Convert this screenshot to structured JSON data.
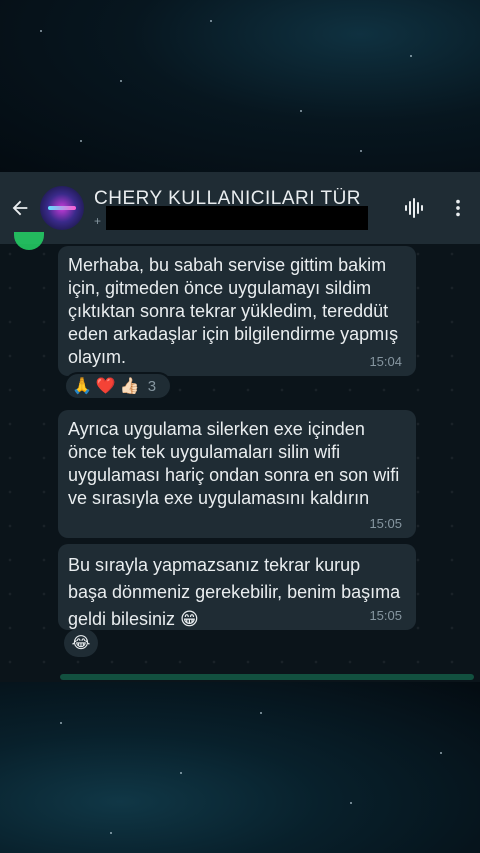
{
  "header": {
    "title": "CHERY KULLANICILARI TÜR",
    "subtitle": "+"
  },
  "messages": [
    {
      "text": "Merhaba, bu sabah servise gittim bakim için, gitmeden önce uygulamayı sildim çıktıktan sonra tekrar yükledim, tereddüt eden arkadaşlar için bilgilendirme yapmış olayım.",
      "time": "15:04",
      "reactions": [
        "🙏",
        "❤️",
        "👍🏻"
      ],
      "reaction_count": "3"
    },
    {
      "text": "Ayrıca uygulama silerken exe içinden önce tek tek uygulamaları silin wifi uygulaması hariç ondan sonra en son wifi ve sırasıyla exe uygulamasını kaldırın",
      "time": "15:05"
    },
    {
      "text": "Bu sırayla yapmazsanız tekrar kurup başa dönmeniz gerekebilir, benim başıma geldi bilesiniz 😁",
      "time": "15:05",
      "reactions": [
        "😂"
      ]
    }
  ],
  "colors": {
    "header_bg": "#1f2c34",
    "bubble_bg": "#1f2c34",
    "chat_bg": "#0b141a",
    "time_text": "#8696a0"
  },
  "icons": {
    "back": "arrow-left-icon",
    "voice": "audio-wave-icon",
    "menu": "more-vertical-icon"
  }
}
